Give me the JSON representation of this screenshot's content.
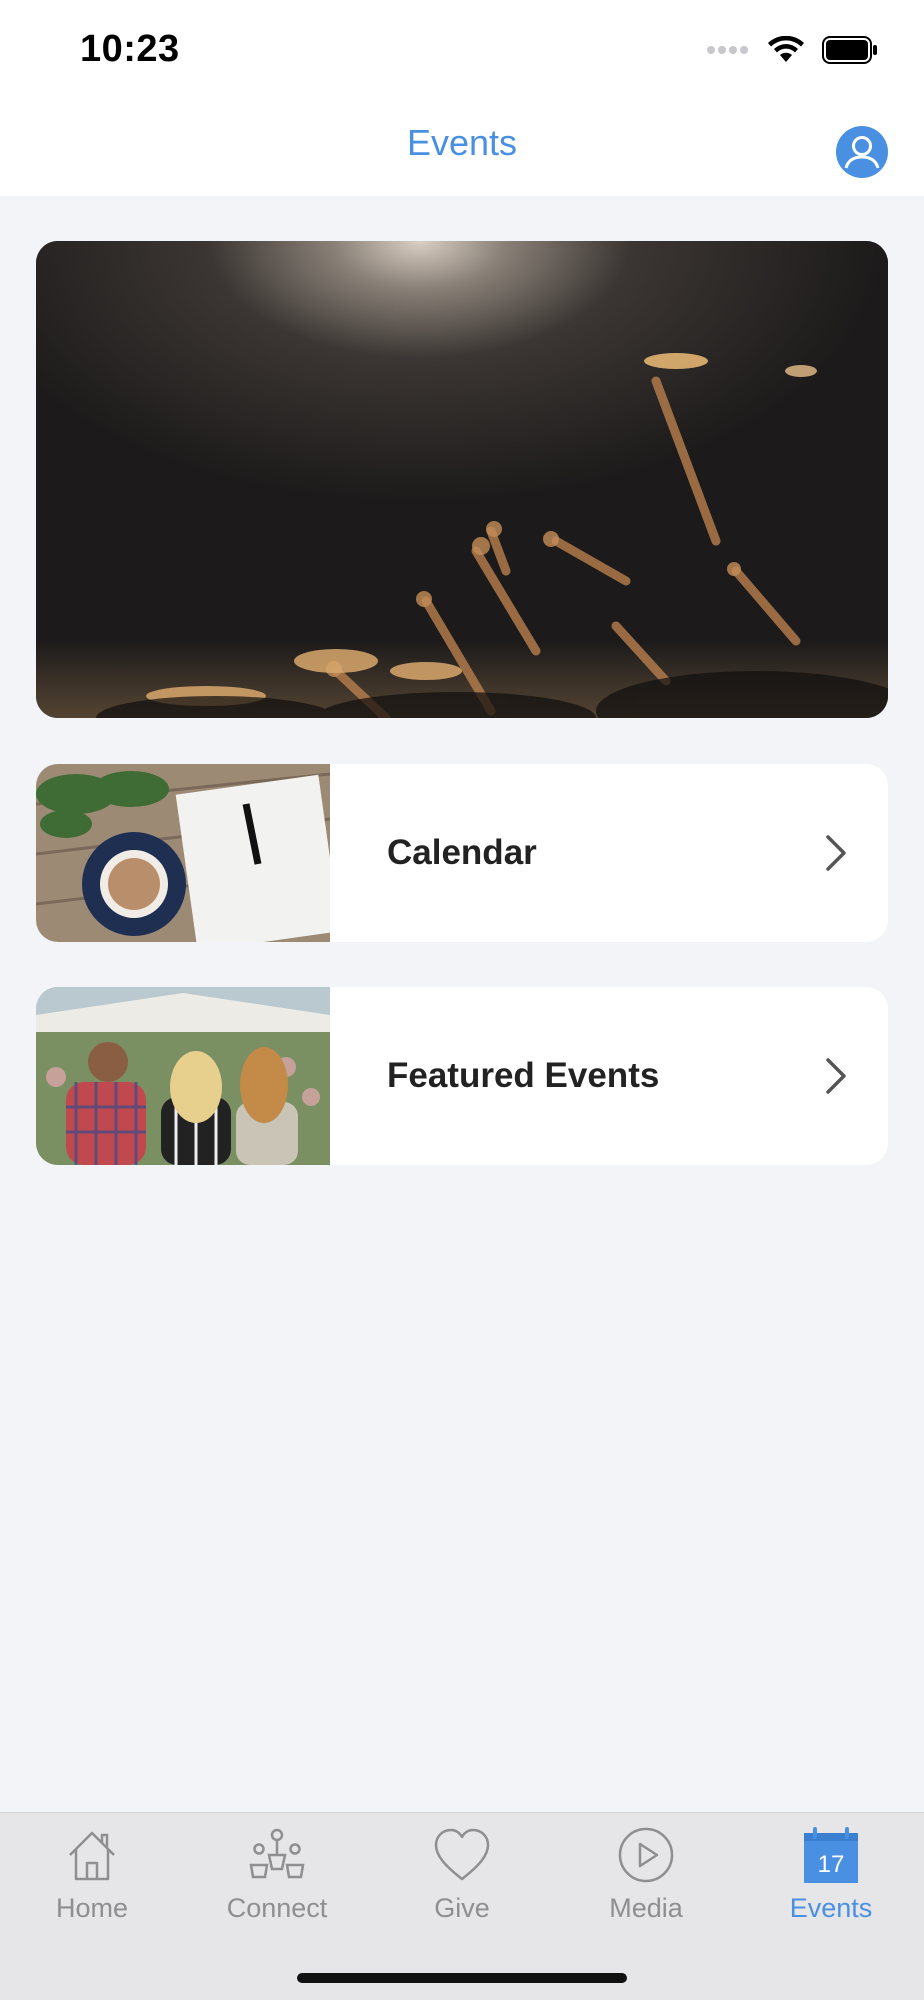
{
  "status_bar": {
    "time": "10:23",
    "icons": [
      "signal-dots-icon",
      "wifi-icon",
      "battery-icon"
    ]
  },
  "nav": {
    "title": "Events",
    "profile_icon": "user-profile-icon"
  },
  "hero": {
    "image": "concert-crowd-raised-hands-photo"
  },
  "menu": [
    {
      "label": "Calendar",
      "thumb": "coffee-and-notebook-photo",
      "icon": "chevron-right-icon"
    },
    {
      "label": "Featured Events",
      "thumb": "people-at-outdoor-festival-photo",
      "icon": "chevron-right-icon"
    }
  ],
  "tabbar": {
    "tabs": [
      {
        "label": "Home",
        "icon": "house-icon",
        "active": false
      },
      {
        "label": "Connect",
        "icon": "people-group-icon",
        "active": false
      },
      {
        "label": "Give",
        "icon": "heart-icon",
        "active": false
      },
      {
        "label": "Media",
        "icon": "play-circle-icon",
        "active": false
      },
      {
        "label": "Events",
        "icon": "calendar-icon",
        "active": true,
        "badge": "17"
      }
    ]
  },
  "colors": {
    "accent": "#4a90e2",
    "background": "#f3f4f8",
    "tab_inactive": "#8e8e93",
    "card_text": "#222222"
  }
}
